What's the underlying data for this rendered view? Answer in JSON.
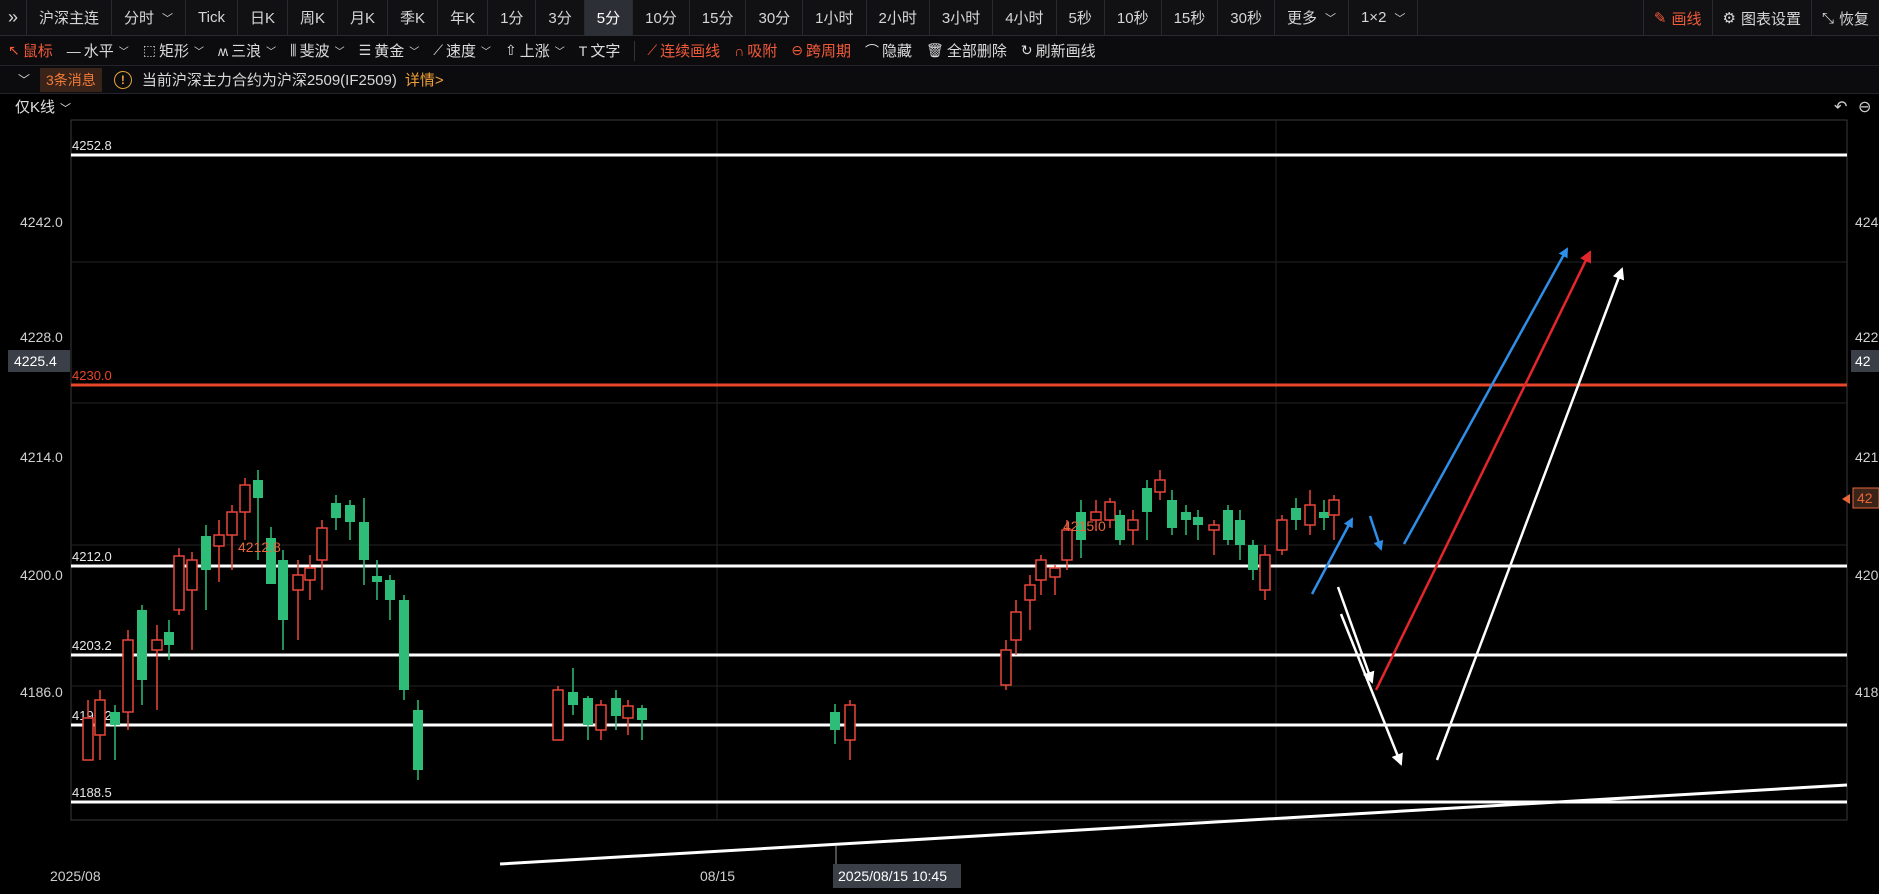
{
  "toolbar": {
    "symbol": "沪深主连",
    "periods": [
      "分时",
      "Tick",
      "日K",
      "周K",
      "月K",
      "季K",
      "年K",
      "1分",
      "3分",
      "5分",
      "10分",
      "15分",
      "30分",
      "1小时",
      "2小时",
      "3小时",
      "4小时",
      "5秒",
      "10秒",
      "15秒",
      "30秒",
      "更多",
      "1×2"
    ],
    "active_period": "5分",
    "draw_label": "画线",
    "chart_settings_label": "图表设置",
    "restore_label": "恢复"
  },
  "drawbar": {
    "tools": [
      "鼠标",
      "水平",
      "矩形",
      "三浪",
      "斐波",
      "黄金",
      "速度",
      "上涨",
      "文字"
    ],
    "actions": [
      "连续画线",
      "吸附",
      "跨周期",
      "隐藏",
      "全部删除",
      "刷新画线"
    ]
  },
  "messages": {
    "count_label": "3条消息",
    "text": "当前沪深主力合约为沪深2509(IF2509)",
    "detail_label": "详情>"
  },
  "chart": {
    "mode_label": "仅K线",
    "y_ticks": [
      "4242.0",
      "4228.0",
      "4214.0",
      "4200.0",
      "4186.0"
    ],
    "right_ticks": [
      "424",
      "422",
      "421",
      "420",
      "418"
    ],
    "current_price": "4225.4",
    "right_current": "42",
    "right_marker": "42",
    "x_labels": [
      "2025/08",
      "08/15"
    ],
    "crosshair_time": "2025/08/15 10:45",
    "horizontal_lines": [
      {
        "label": "4252.8",
        "color": "#ffffff"
      },
      {
        "label": "4230.0",
        "color": "#e8462a"
      },
      {
        "label": "4212.0",
        "color": "#ffffff"
      },
      {
        "label": "4203.2",
        "color": "#ffffff"
      },
      {
        "label": "4196.2",
        "color": "#ffffff"
      },
      {
        "label": "4188.5",
        "color": "#ffffff"
      }
    ],
    "annotations": [
      {
        "label": "4212.8"
      },
      {
        "label": "4215.0"
      }
    ],
    "colors": {
      "up": "#e8463a",
      "down": "#2ebd78",
      "blue_arrow": "#2f8fe8",
      "red_arrow": "#e5262a",
      "white_arrow": "#ffffff"
    }
  }
}
